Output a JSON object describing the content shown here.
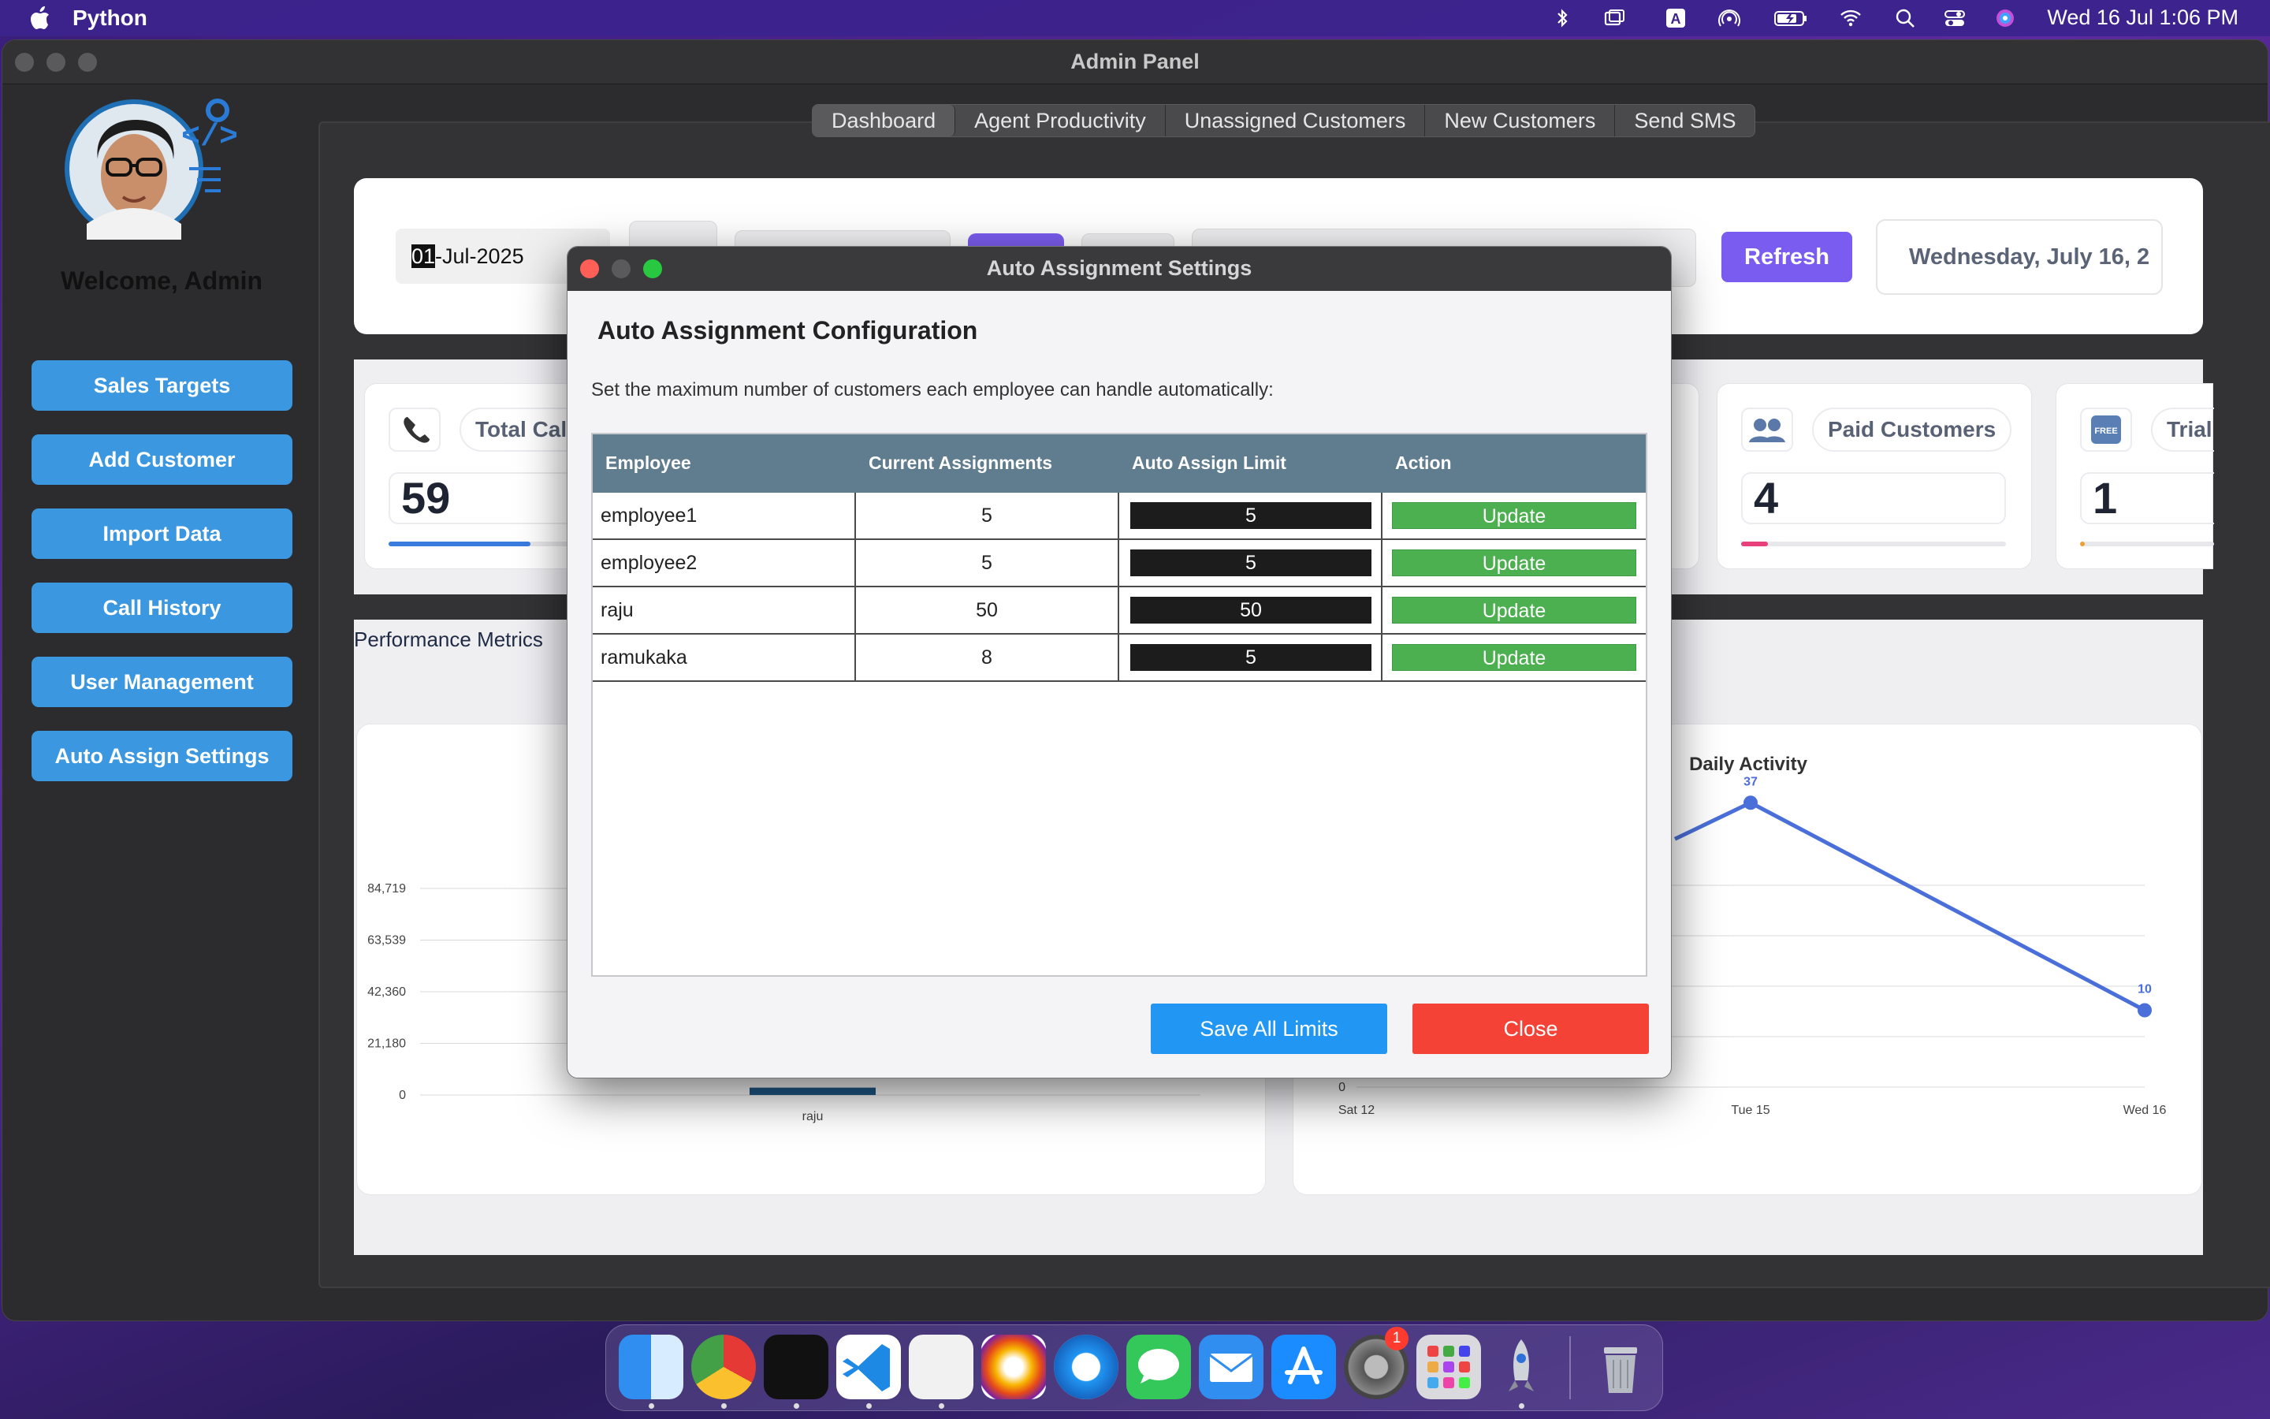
{
  "menubar": {
    "app_name": "Python",
    "clock": "Wed 16 Jul  1:06 PM"
  },
  "window": {
    "title": "Admin Panel"
  },
  "sidebar": {
    "welcome": "Welcome, Admin",
    "buttons": [
      "Sales Targets",
      "Add Customer",
      "Import Data",
      "Call History",
      "User Management",
      "Auto Assign Settings"
    ]
  },
  "tabs": [
    "Dashboard",
    "Agent Productivity",
    "Unassigned Customers",
    "New Customers",
    "Send SMS"
  ],
  "toolbar": {
    "date_selected": "01",
    "date_rest": "-Jul-2025",
    "refresh_label": "Refresh",
    "today": "Wednesday, July 16, 2"
  },
  "stats": {
    "total_calls": {
      "label": "Total Calls",
      "value": "59",
      "progress": 0.6
    },
    "paid_customers": {
      "label": "Paid Customers",
      "value": "4",
      "progress": 0.1
    },
    "trial": {
      "label": "Trial",
      "value": "1",
      "progress": 0.03
    }
  },
  "performance_title": "Performance Metrics",
  "chart_data": [
    {
      "type": "bar",
      "categories": [
        "raju"
      ],
      "values": [
        3000
      ],
      "yticks": [
        "84,719",
        "63,539",
        "42,360",
        "21,180",
        "0"
      ],
      "ylim": [
        0,
        105899
      ]
    },
    {
      "type": "line",
      "title": "Daily Activity",
      "x": [
        "Sat 12",
        "Tue 15",
        "Wed 16"
      ],
      "points": [
        {
          "x": "Tue 15",
          "y": 37,
          "label": "37"
        },
        {
          "x": "Wed 16",
          "y": 10,
          "label": "10"
        }
      ],
      "ytick_zero": "0",
      "color": "#4a6fd8"
    }
  ],
  "modal": {
    "title": "Auto Assignment Settings",
    "heading": "Auto Assignment Configuration",
    "description": "Set the maximum number of customers each employee can handle automatically:",
    "columns": [
      "Employee",
      "Current Assignments",
      "Auto Assign Limit",
      "Action"
    ],
    "rows": [
      {
        "employee": "employee1",
        "current": "5",
        "limit": "5",
        "action": "Update"
      },
      {
        "employee": "employee2",
        "current": "5",
        "limit": "5",
        "action": "Update"
      },
      {
        "employee": "raju",
        "current": "50",
        "limit": "50",
        "action": "Update"
      },
      {
        "employee": "ramukaka",
        "current": "8",
        "limit": "5",
        "action": "Update"
      }
    ],
    "save_label": "Save All Limits",
    "close_label": "Close"
  },
  "dock": {
    "badge": "1"
  },
  "colors": {
    "accent": "#3a97e0",
    "refresh": "#7b5cf0",
    "update": "#4caf50",
    "close": "#f44336",
    "save": "#2196f3",
    "table_header": "#5f7d8e"
  }
}
